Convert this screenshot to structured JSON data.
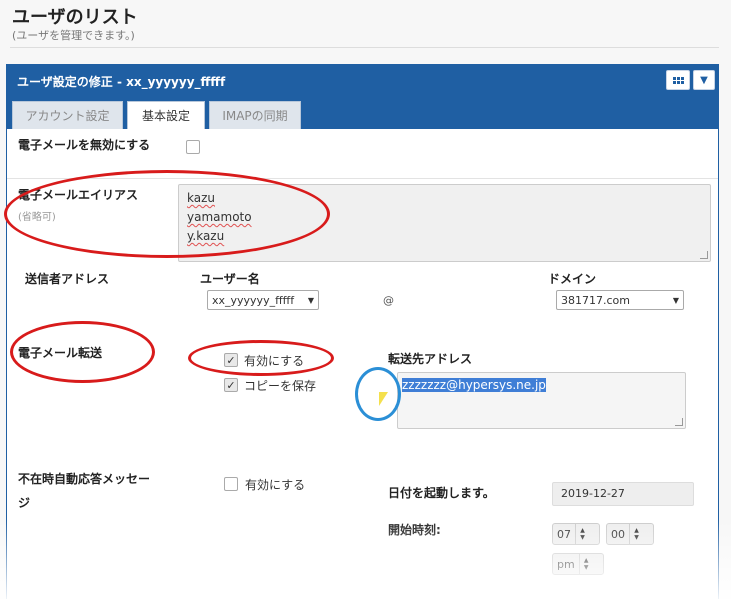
{
  "page": {
    "title": "ユーザのリスト",
    "subtitle": "(ユーザを管理できます。)"
  },
  "panel": {
    "title": "ユーザ設定の修正 - xx_yyyyyy_fffff",
    "tabs": [
      {
        "label": "アカウント設定",
        "active": false
      },
      {
        "label": "基本設定",
        "active": true
      },
      {
        "label": "IMAPの同期",
        "active": false
      }
    ]
  },
  "form": {
    "disable_email": {
      "label": "電子メールを無効にする",
      "checked": false
    },
    "aliases": {
      "label": "電子メールエイリアス",
      "note": "(省略可)",
      "lines": [
        "kazu",
        "yamamoto",
        "y.kazu"
      ]
    },
    "sender_address": {
      "label": "送信者アドレス",
      "username_label": "ユーザー名",
      "username_value": "xx_yyyyyy_fffff",
      "at": "@",
      "domain_label": "ドメイン",
      "domain_value": "381717.com"
    },
    "forwarding": {
      "label": "電子メール転送",
      "enable_label": "有効にする",
      "enable_checked": true,
      "keep_copy_label": "コピーを保存",
      "keep_copy_checked": true,
      "dest_label": "転送先アドレス",
      "dest_value": "zzzzzzz@hypersys.ne.jp"
    },
    "autoreply": {
      "label_line1": "不在時自動応答メッセー",
      "label_line2": "ジ",
      "enable_label": "有効にする",
      "enable_checked": false,
      "date_label": "日付を起動します。",
      "date_value": "2019-12-27",
      "start_label": "開始時刻:",
      "hour": "07",
      "minute": "00",
      "ampm": "pm"
    }
  },
  "icons": {
    "check": "✓",
    "caret": "▼",
    "step_up": "▲",
    "step_down": "▼"
  },
  "annotation_colors": {
    "ellipse": "#d81b1b",
    "cursor": "#2b8fd6"
  }
}
